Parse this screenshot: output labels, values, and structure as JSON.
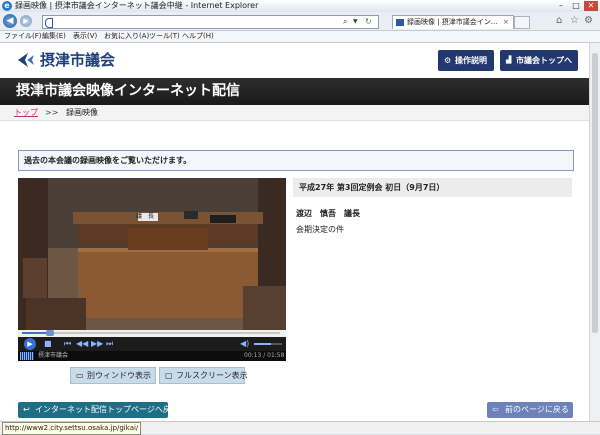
{
  "window": {
    "title": "録画映像 | 摂津市議会インターネット議会中継 - Internet Explorer",
    "ie_logo": "e",
    "minimize": "–",
    "maximize": "□",
    "close": "✕"
  },
  "browser": {
    "back_icon": "◀",
    "forward_icon": "▶",
    "url": "",
    "tab_title": "録画映像 | 摂津市議会イン...",
    "tab_close": "×",
    "home_icon": "⌂",
    "favorites_icon": "☆",
    "tools_icon": "⚙"
  },
  "menu": [
    "ファイル(F)",
    "編集(E)",
    "表示(V)",
    "お気に入り(A)",
    "ツール(T)",
    "ヘルプ(H)"
  ],
  "header": {
    "site_title": "摂津市議会",
    "help_button": "操作説明",
    "top_button": "市議会トップへ"
  },
  "banner": {
    "title": "摂津市議会映像インターネット配信"
  },
  "breadcrumb": {
    "top": "トップ",
    "separator": ">>",
    "current": "録画映像"
  },
  "notice": "過去の本会議の録画映像をご覧いただけます。",
  "player": {
    "channel_label": "摂津市議会",
    "time": "00:13 / 01:58",
    "progress": 0.11,
    "volume": 0.6,
    "play_icon": "▶",
    "stop_icon": "■",
    "prev_icon": "⏮",
    "rewind_icon": "◀◀",
    "forward_icon": "▶▶",
    "next_icon": "⏭",
    "volume_icon": "◀)",
    "podium_label": "議　長"
  },
  "video_buttons": {
    "separate_window": "別ウィンドウ表示",
    "fullscreen": "フルスクリーン表示"
  },
  "meeting": {
    "title": "平成27年 第3回定例会 初日（9月7日）",
    "speaker": "渡辺　慎吾　議長",
    "agenda": "会期決定の件"
  },
  "footer": {
    "top_page_button": "インターネット配信トップページへ戻る",
    "back_button": "前のページに戻る"
  },
  "status_bar": {
    "url": "http://www2.city.settsu.osaka.jp/gikai/"
  },
  "colors": {
    "navy": "#22386e",
    "banner": "#1f1f1f",
    "teal": "#1e6f86",
    "breadcrumb_link": "#c0306a"
  }
}
